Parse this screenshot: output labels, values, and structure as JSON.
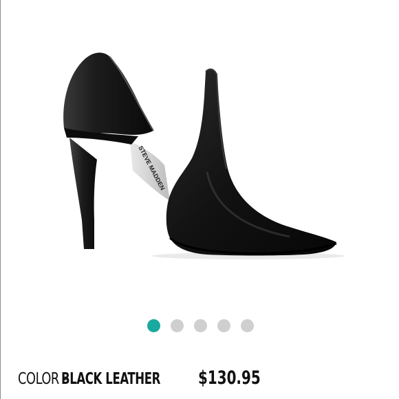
{
  "product": {
    "color_prefix": "COLOR - ",
    "color_name": "BLACK LEATHER",
    "price": "$130.95",
    "image_icon": "black-pointed-toe-stiletto-pump",
    "insole_brand_text": "STEVE MADDEN"
  },
  "carousel": {
    "total": 5,
    "active_index": 0,
    "active_color": "#1aa99f",
    "inactive_color": "#cfcfcf"
  }
}
